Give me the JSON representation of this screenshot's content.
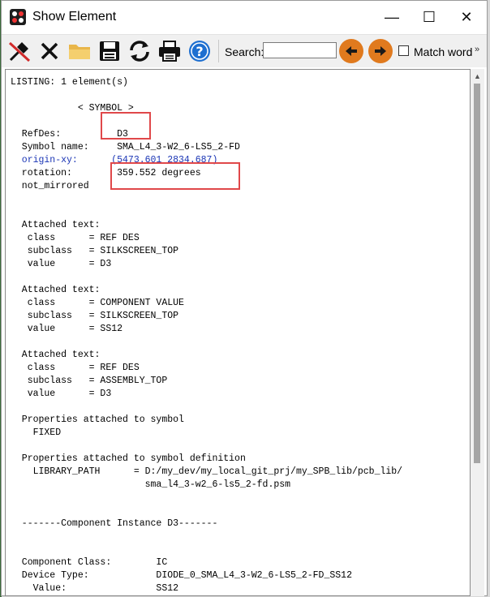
{
  "window": {
    "title": "Show Element",
    "controls": {
      "minimize": "—",
      "maximize": "☐",
      "close": "✕"
    }
  },
  "toolbar": {
    "buttons": [
      {
        "name": "pin-icon"
      },
      {
        "name": "close-x-icon"
      },
      {
        "name": "folder-icon"
      },
      {
        "name": "save-icon"
      },
      {
        "name": "refresh-icon"
      },
      {
        "name": "printer-icon"
      },
      {
        "name": "help-icon"
      }
    ],
    "search_label": "Search:",
    "search_value": "",
    "match_word_label": "Match word",
    "match_word_checked": false,
    "more_glyph": "»"
  },
  "listing": {
    "lines": [
      "LISTING: 1 element(s)",
      "",
      "            < SYMBOL >",
      "",
      "  RefDes:          D3",
      "  Symbol name:     SMA_L4_3-W2_6-LS5_2-FD",
      "  origin-xy:      (5473.601 2834.687)",
      "  rotation:        359.552 degrees",
      "  not_mirrored",
      "",
      "",
      "  Attached text:",
      "   class      = REF DES",
      "   subclass   = SILKSCREEN_TOP",
      "   value      = D3",
      "",
      "  Attached text:",
      "   class      = COMPONENT VALUE",
      "   subclass   = SILKSCREEN_TOP",
      "   value      = SS12",
      "",
      "  Attached text:",
      "   class      = REF DES",
      "   subclass   = ASSEMBLY_TOP",
      "   value      = D3",
      "",
      "  Properties attached to symbol",
      "    FIXED",
      "",
      "  Properties attached to symbol definition",
      "    LIBRARY_PATH      = D:/my_dev/my_local_git_prj/my_SPB_lib/pcb_lib/",
      "                        sma_l4_3-w2_6-ls5_2-fd.psm",
      "",
      "",
      "  -------Component Instance D3-------",
      "",
      "",
      "  Component Class:        IC",
      "  Device Type:            DIODE_0_SMA_L4_3-W2_6-LS5_2-FD_SS12",
      "    Value:                SS12"
    ],
    "link_line_index": 6
  },
  "colors": {
    "highlight": "#e0484a",
    "link": "#1a35b5",
    "nav_arrow": "#e07a1e",
    "help_icon": "#1e6fd0"
  }
}
